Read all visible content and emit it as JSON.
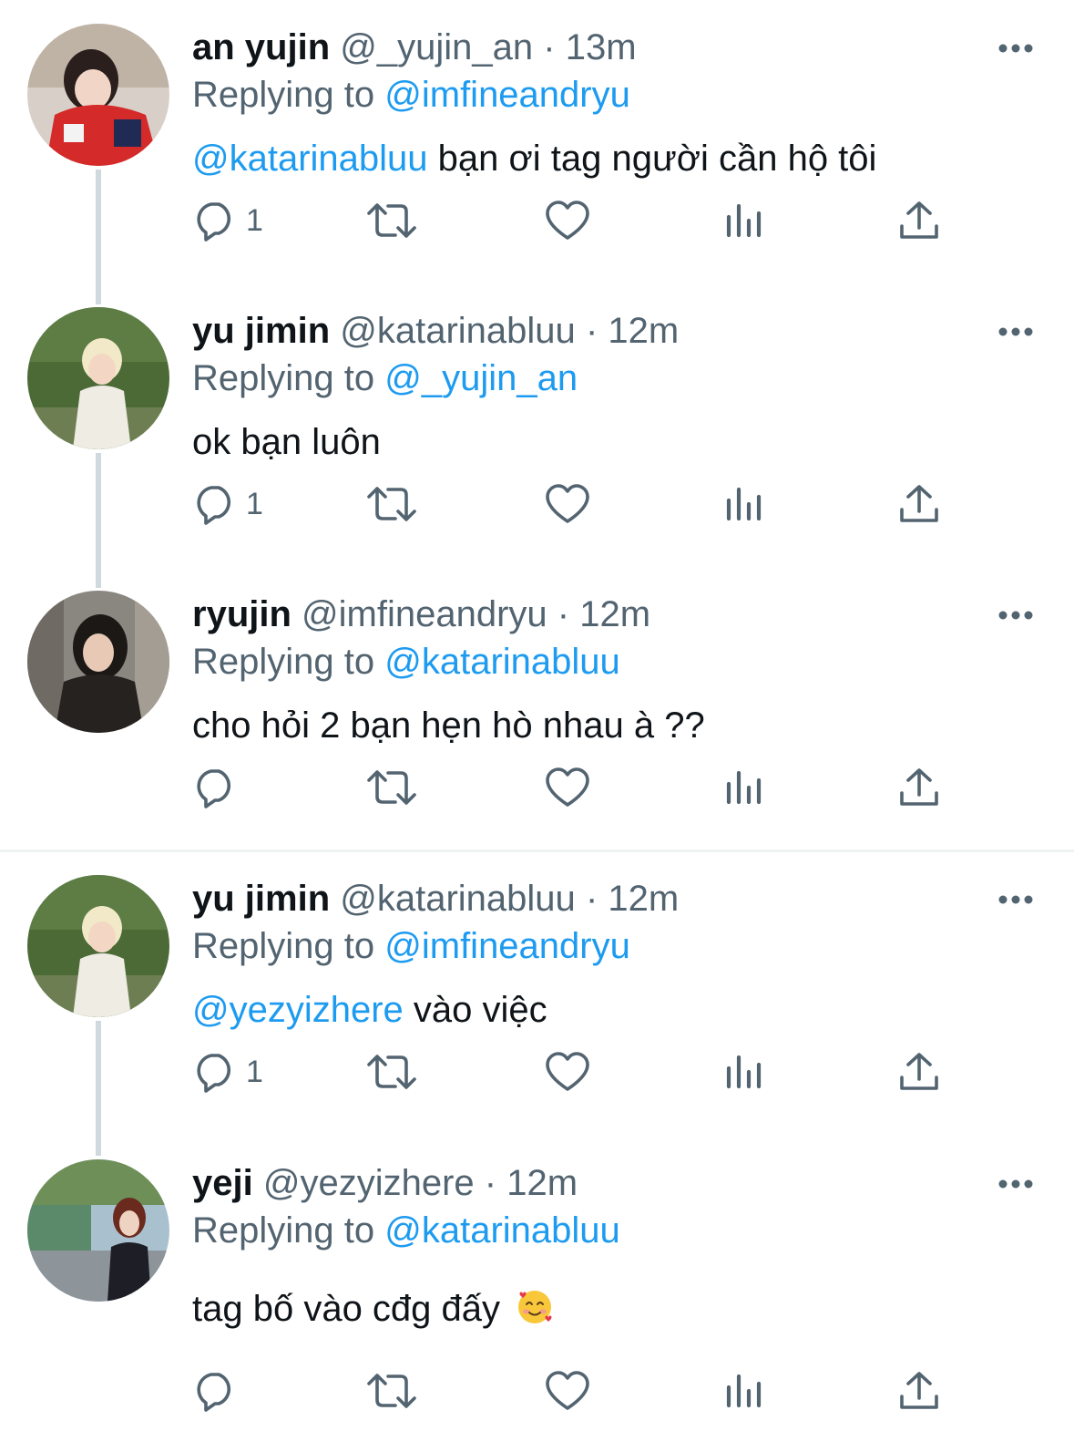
{
  "tweets": [
    {
      "name": "an yujin",
      "handle": "@_yujin_an",
      "dot": "·",
      "time": "13m",
      "replying_prefix": "Replying to",
      "replying_to": "@imfineandryu",
      "mention": "@katarinabluu",
      "text": " bạn ơi tag người cần hộ tôi",
      "reply_count": "1",
      "avatar_icon": "avatar-photo"
    },
    {
      "name": "yu jimin",
      "handle": "@katarinabluu",
      "dot": "·",
      "time": "12m",
      "replying_prefix": "Replying to",
      "replying_to": "@_yujin_an",
      "mention": "",
      "text": "ok bạn luôn",
      "reply_count": "1",
      "avatar_icon": "avatar-photo"
    },
    {
      "name": "ryujin",
      "handle": "@imfineandryu",
      "dot": "·",
      "time": "12m",
      "replying_prefix": "Replying to",
      "replying_to": "@katarinabluu",
      "mention": "",
      "text": "cho hỏi 2 bạn hẹn hò nhau à ??",
      "reply_count": "",
      "avatar_icon": "avatar-photo"
    },
    {
      "name": "yu jimin",
      "handle": "@katarinabluu",
      "dot": "·",
      "time": "12m",
      "replying_prefix": "Replying to",
      "replying_to": "@imfineandryu",
      "mention": "@yezyizhere",
      "text": " vào việc",
      "reply_count": "1",
      "avatar_icon": "avatar-photo"
    },
    {
      "name": "yeji",
      "handle": "@yezyizhere",
      "dot": "·",
      "time": "12m",
      "replying_prefix": "Replying to",
      "replying_to": "@katarinabluu",
      "mention": "",
      "text": "tag bố vào cđg đấy ",
      "reply_count": "",
      "avatar_icon": "avatar-photo",
      "emoji_icon": "smiling-face-with-hearts-emoji"
    }
  ],
  "icons": {
    "reply": "reply-bubble-icon",
    "retweet": "retweet-icon",
    "like": "heart-icon",
    "views": "views-bar-chart-icon",
    "share": "share-upload-icon",
    "more": "more-dots-icon"
  },
  "colors": {
    "link": "#1d9bf0",
    "secondary_text": "#536471",
    "primary_text": "#0f1419",
    "thread_line": "#cfd9de",
    "divider": "#eff3f4"
  }
}
